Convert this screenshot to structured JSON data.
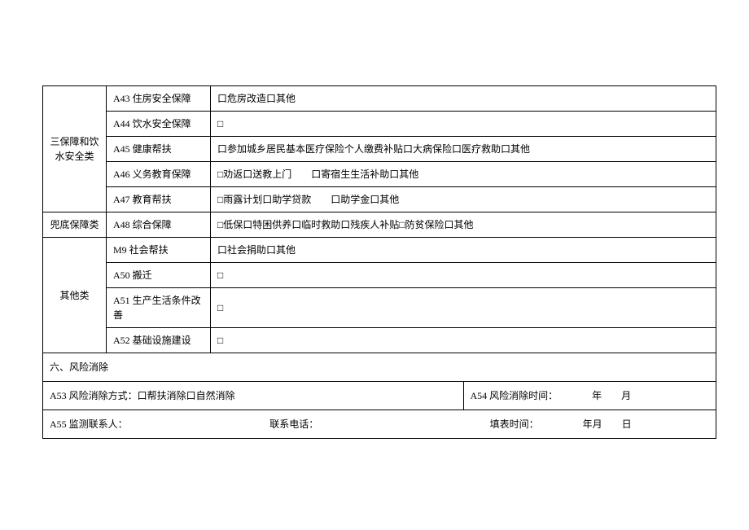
{
  "categories": {
    "c1": "三保障和饮水安全类",
    "c2": "兜底保障类",
    "c3": "其他类"
  },
  "rows": {
    "a43": {
      "label": "A43 住房安全保障",
      "value": "口危房改造口其他"
    },
    "a44": {
      "label": "A44 饮水安全保障",
      "value": "□"
    },
    "a45": {
      "label": "A45 健康帮扶",
      "value": "口参加城乡居民基本医疗保险个人缴费补贴口大病保险口医疗救助口其他"
    },
    "a46": {
      "label": "A46 义务教育保障",
      "value": "□劝返口送教上门　　口寄宿生生活补助口其他"
    },
    "a47": {
      "label": "A47 教育帮扶",
      "value": "□雨露计划口助学贷款　　口助学金口其他"
    },
    "a48": {
      "label": "A48 综合保障",
      "value": "□低保口特困供养口临时救助口残疾人补贴□防贫保险口其他"
    },
    "m9": {
      "label": "M9 社会帮扶",
      "value": "口社会捐助口其他"
    },
    "a50": {
      "label": "A50 搬迁",
      "value": "□"
    },
    "a51": {
      "label": "A51 生产生活条件改善",
      "value": "□"
    },
    "a52": {
      "label": "A52 基础设施建设",
      "value": "□"
    }
  },
  "section6": "六、风险消除",
  "footer": {
    "a53": "A53 风险消除方式：口帮扶消除口自然消除",
    "a54": "A54 风险消除时间：　　　　年　　月",
    "a55_contact": "A55 监测联系人：",
    "a55_phone": "联系电话：",
    "a55_time": "填表时间：　　　　　年月　　日"
  }
}
